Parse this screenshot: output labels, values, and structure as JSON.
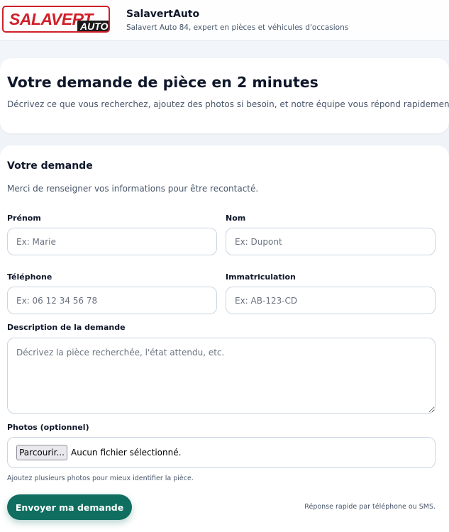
{
  "header": {
    "logo_main": "SALAVERT",
    "logo_sub": "AUTO",
    "brand_title": "SalavertAuto",
    "brand_subtitle": "Salavert Auto 84, expert en pièces et véhicules d'occasions"
  },
  "hero": {
    "title": "Votre demande de pièce en 2 minutes",
    "subtitle": "Décrivez ce que vous recherchez, ajoutez des photos si besoin, et notre équipe vous répond rapidement."
  },
  "form": {
    "title": "Votre demande",
    "intro": "Merci de renseigner vos informations pour être recontacté.",
    "firstname": {
      "label": "Prénom",
      "placeholder": "Ex: Marie"
    },
    "lastname": {
      "label": "Nom",
      "placeholder": "Ex: Dupont"
    },
    "phone": {
      "label": "Téléphone",
      "placeholder": "Ex: 06 12 34 56 78"
    },
    "plate": {
      "label": "Immatriculation",
      "placeholder": "Ex: AB-123-CD"
    },
    "description": {
      "label": "Description de la demande",
      "placeholder": "Décrivez la pièce recherchée, l'état attendu, etc."
    },
    "photos": {
      "label": "Photos (optionnel)",
      "button": "Parcourir...",
      "status": "Aucun fichier sélectionné.",
      "hint": "Ajoutez plusieurs photos pour mieux identifier la pièce."
    },
    "submit_label": "Envoyer ma demande",
    "note": "Réponse rapide par téléphone ou SMS."
  },
  "colors": {
    "brand_red": "#d0202a",
    "submit_green": "#0f6e60"
  }
}
